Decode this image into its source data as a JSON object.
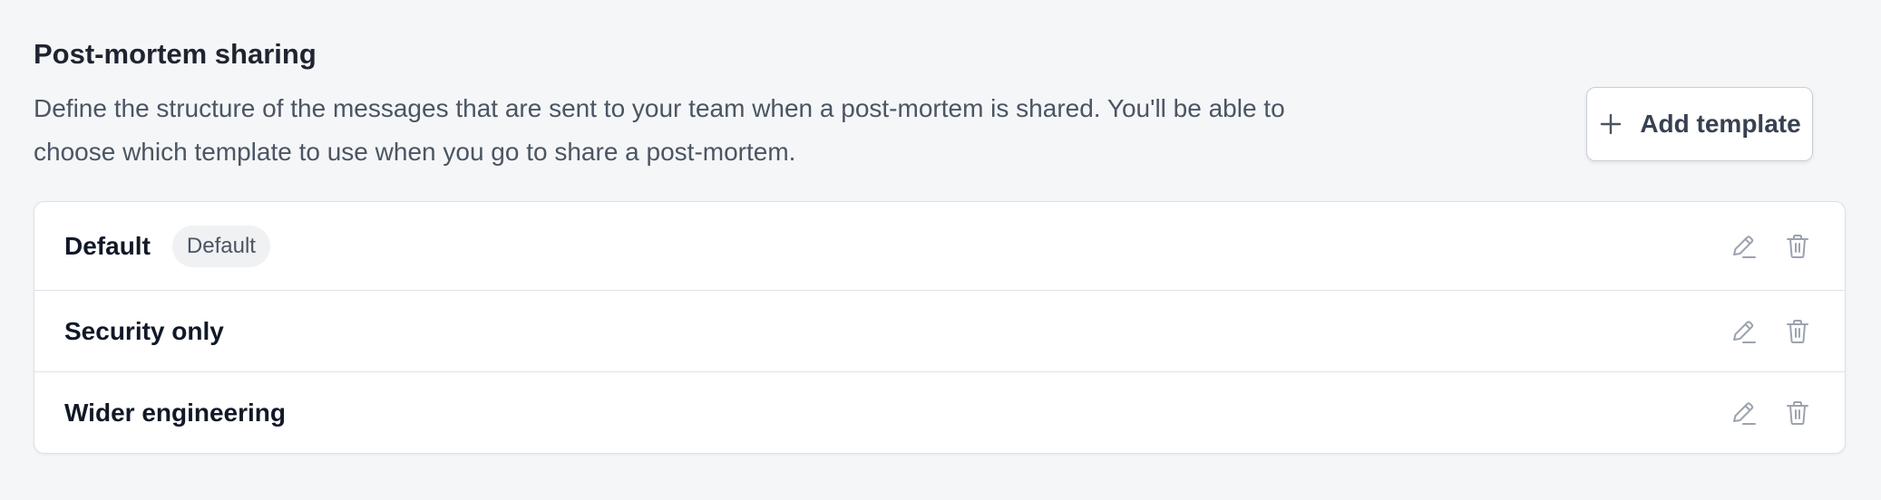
{
  "section": {
    "title": "Post-mortem sharing",
    "description": "Define the structure of the messages that are sent to your team when a post-mortem is shared. You'll be able to choose which template to use when you go to share a post-mortem."
  },
  "add_button": {
    "label": "Add template",
    "icon": "plus-icon"
  },
  "templates": [
    {
      "name": "Default",
      "badge": "Default"
    },
    {
      "name": "Security only"
    },
    {
      "name": "Wider engineering"
    }
  ],
  "row_actions": {
    "edit_icon": "pencil-icon",
    "delete_icon": "trash-icon"
  },
  "colors": {
    "background": "#f5f6f8",
    "card": "#ffffff",
    "border": "#dde1e6",
    "text_primary": "#111827",
    "text_secondary": "#4b5563",
    "icon": "#9ca3af"
  }
}
